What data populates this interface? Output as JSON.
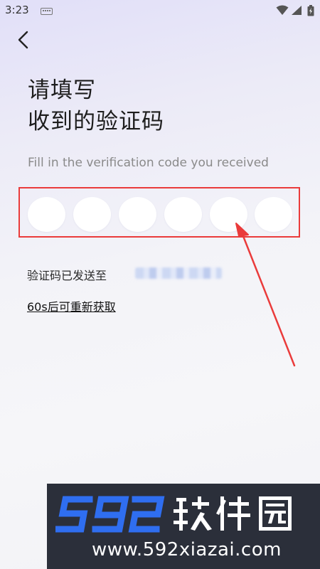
{
  "status_bar": {
    "time": "3:23",
    "icons": [
      "keyboard-icon",
      "wifi-icon",
      "signal-icon",
      "battery-icon"
    ]
  },
  "nav": {
    "back_icon": "chevron-left-icon"
  },
  "header": {
    "title_line1": "请填写",
    "title_line2": "收到的验证码",
    "subtitle": "Fill in the verification code you received"
  },
  "code_input": {
    "digit_count": 6,
    "values": [
      "",
      "",
      "",
      "",
      "",
      ""
    ]
  },
  "info": {
    "sent_to_label": "验证码已发送至",
    "resend_label": "60s后可重新获取"
  },
  "colors": {
    "annotation_red": "#ea3b3b",
    "watermark_blue": "#2f6ef0",
    "watermark_bg": "#2b2f3a"
  },
  "watermark": {
    "logo_text": "592软件园",
    "url": "www.592xiazai.com"
  }
}
